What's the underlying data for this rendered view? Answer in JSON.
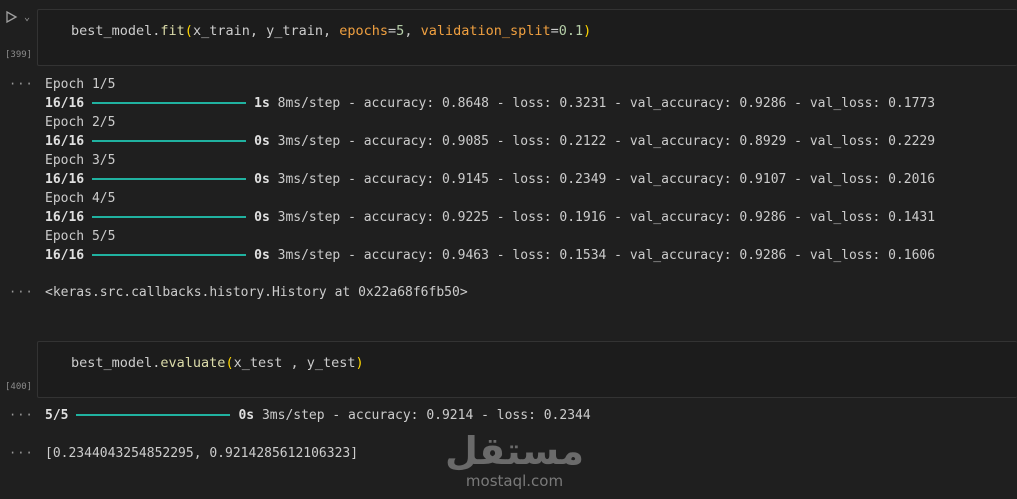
{
  "cells": [
    {
      "exec_count": "[399]",
      "code": {
        "pre": "best_model.",
        "fn": "fit",
        "open": "(",
        "args_a": "x_train, y_train, ",
        "kw1": "epochs",
        "eq1": "=",
        "num1": "5",
        "sep": ", ",
        "kw2": "validation_split",
        "eq2": "=",
        "num2": "0.1",
        "close": ")"
      },
      "output": {
        "dots": "···",
        "epochs": [
          {
            "label": "Epoch 1/5",
            "step": "16/16",
            "time": "1s",
            "rest": "8ms/step - accuracy: 0.8648 - loss: 0.3231 - val_accuracy: 0.9286 - val_loss: 0.1773"
          },
          {
            "label": "Epoch 2/5",
            "step": "16/16",
            "time": "0s",
            "rest": "3ms/step - accuracy: 0.9085 - loss: 0.2122 - val_accuracy: 0.8929 - val_loss: 0.2229"
          },
          {
            "label": "Epoch 3/5",
            "step": "16/16",
            "time": "0s",
            "rest": "3ms/step - accuracy: 0.9145 - loss: 0.2349 - val_accuracy: 0.9107 - val_loss: 0.2016"
          },
          {
            "label": "Epoch 4/5",
            "step": "16/16",
            "time": "0s",
            "rest": "3ms/step - accuracy: 0.9225 - loss: 0.1916 - val_accuracy: 0.9286 - val_loss: 0.1431"
          },
          {
            "label": "Epoch 5/5",
            "step": "16/16",
            "time": "0s",
            "rest": "3ms/step - accuracy: 0.9463 - loss: 0.1534 - val_accuracy: 0.9286 - val_loss: 0.1606"
          }
        ],
        "result_dots": "···",
        "result": "<keras.src.callbacks.history.History at 0x22a68f6fb50>"
      }
    },
    {
      "exec_count": "[400]",
      "code": {
        "pre": "best_model.",
        "fn": "evaluate",
        "open": "(",
        "args": "x_test , y_test",
        "close": ")"
      },
      "output": {
        "dots": "···",
        "step": "5/5",
        "time": "0s",
        "rest": "3ms/step - accuracy: 0.9214 - loss: 0.2344",
        "result_dots": "···",
        "result": "[0.2344043254852295, 0.9214285612106323]"
      }
    }
  ],
  "watermark": {
    "arabic": "مستقل",
    "latin": "mostaql.com"
  },
  "colors": {
    "progress": "#20b2a0",
    "background": "#1f1f1f"
  }
}
